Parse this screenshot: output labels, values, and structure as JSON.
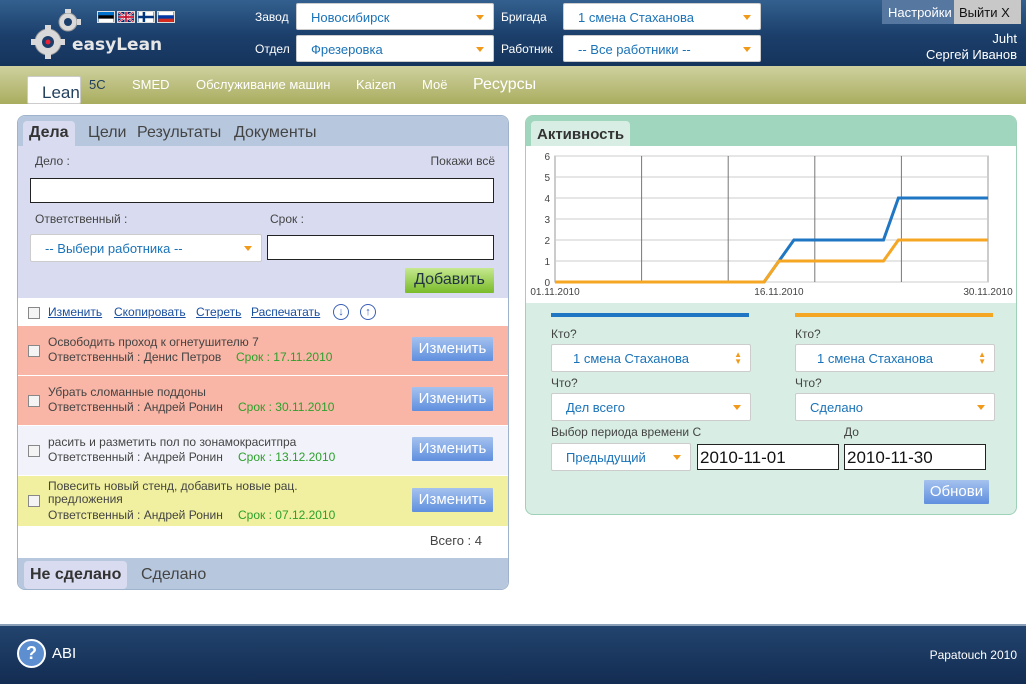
{
  "header": {
    "logo_text": "easyLean",
    "flags": [
      "estonia-flag",
      "uk-flag",
      "finland-flag",
      "russia-flag"
    ],
    "plant_label": "Завод",
    "plant_value": "Новосибирск",
    "dept_label": "Отдел",
    "dept_value": "Фрезеровка",
    "brigade_label": "Бригада",
    "brigade_value": "1 смена Стаханова",
    "worker_label": "Работник",
    "worker_value": "-- Все работники --",
    "settings_label": "Настройки",
    "logout_label": "Выйти X",
    "user_login": "Juht",
    "user_name": "Сергей Иванов"
  },
  "nav": {
    "items": [
      "Lean",
      "5C",
      "SMED",
      "Обслуживание машин",
      "Kaizen",
      "Моё",
      "Ресурсы"
    ]
  },
  "tasks_panel": {
    "tabs": [
      "Дела",
      "Цели",
      "Результаты",
      "Документы"
    ],
    "task_label": "Дело :",
    "show_all": "Покажи всё",
    "responsible_label": "Ответственный :",
    "responsible_placeholder": "-- Выбери работника --",
    "due_label": "Срок :",
    "add_button": "Добавить",
    "actions": [
      "Изменить",
      "Скопировать",
      "Стереть",
      "Распечатать"
    ],
    "rows": [
      {
        "title": "Освободить проход к огнетушителю 7",
        "responsible": "Ответственный : Денис Петров",
        "due": "Срок : 17.11.2010",
        "button": "Изменить",
        "color": "#f9b5a5"
      },
      {
        "title": "Убрать сломанные поддоны",
        "responsible": "Ответственный : Андрей Ронин",
        "due": "Срок : 30.11.2010",
        "button": "Изменить",
        "color": "#f9b5a5"
      },
      {
        "title": "расить и разметить пол по зонамокраситпра",
        "responsible": "Ответственный : Андрей Ронин",
        "due": "Срок : 13.12.2010",
        "button": "Изменить",
        "color": "#f2f3fa"
      },
      {
        "title": "Повесить новый стенд, добавить новые рац. предложения",
        "responsible": "Ответственный : Андрей Ронин",
        "due": "Срок : 07.12.2010",
        "button": "Изменить",
        "color": "#f0f0a0"
      }
    ],
    "total": "Всего : 4",
    "bottom_tabs": [
      "Не сделано",
      "Сделано"
    ]
  },
  "activity_panel": {
    "title": "Активность",
    "blue_color": "#1f77c4",
    "orange_color": "#f5a623",
    "who_label": "Кто?",
    "who_left": "1 смена Стаханова",
    "who_right": "1 смена Стаханова",
    "what_label": "Что?",
    "what_left": "Дел всего",
    "what_right": "Сделано",
    "period_label": "Выбор периода времени С",
    "to_label": "До",
    "period_value": "Предыдущий",
    "from_date": "2010-11-01",
    "to_date": "2010-11-30",
    "refresh_button": "Обнови"
  },
  "chart_data": {
    "type": "line",
    "x": [
      "01.11.2010",
      "02.11.2010",
      "03.11.2010",
      "04.11.2010",
      "05.11.2010",
      "06.11.2010",
      "07.11.2010",
      "08.11.2010",
      "09.11.2010",
      "10.11.2010",
      "11.11.2010",
      "12.11.2010",
      "13.11.2010",
      "14.11.2010",
      "15.11.2010",
      "16.11.2010",
      "17.11.2010",
      "18.11.2010",
      "19.11.2010",
      "20.11.2010",
      "21.11.2010",
      "22.11.2010",
      "23.11.2010",
      "24.11.2010",
      "25.11.2010",
      "26.11.2010",
      "27.11.2010",
      "28.11.2010",
      "29.11.2010",
      "30.11.2010"
    ],
    "x_tick_labels": [
      "01.11.2010",
      "16.11.2010",
      "30.11.2010"
    ],
    "y_ticks": [
      0,
      1,
      2,
      3,
      4,
      5,
      6
    ],
    "ylim": [
      0,
      6
    ],
    "grid": true,
    "series": [
      {
        "color": "#1f77c4",
        "values": [
          0,
          0,
          0,
          0,
          0,
          0,
          0,
          0,
          0,
          0,
          0,
          0,
          0,
          0,
          0,
          1,
          2,
          2,
          2,
          2,
          2,
          2,
          2,
          4,
          4,
          4,
          4,
          4,
          4,
          4
        ]
      },
      {
        "color": "#f5a623",
        "values": [
          0,
          0,
          0,
          0,
          0,
          0,
          0,
          0,
          0,
          0,
          0,
          0,
          0,
          0,
          0,
          1,
          1,
          1,
          1,
          1,
          1,
          1,
          1,
          2,
          2,
          2,
          2,
          2,
          2,
          2
        ]
      }
    ]
  },
  "footer": {
    "help_label": "ABI",
    "copyright": "Papatouch 2010"
  }
}
